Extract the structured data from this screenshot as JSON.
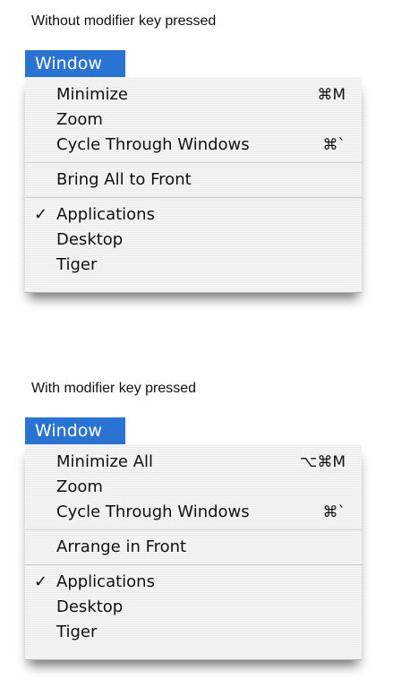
{
  "sections": [
    {
      "caption": "Without modifier key pressed",
      "menu_title": "Window",
      "group1": [
        {
          "label": "Minimize",
          "shortcut": "⌘M"
        },
        {
          "label": "Zoom",
          "shortcut": ""
        },
        {
          "label": "Cycle Through Windows",
          "shortcut": "⌘`"
        }
      ],
      "group2": [
        {
          "label": "Bring All to Front",
          "shortcut": ""
        }
      ],
      "group3": [
        {
          "label": "Applications",
          "checked": true,
          "check_glyph": "✓"
        },
        {
          "label": "Desktop",
          "checked": false
        },
        {
          "label": "Tiger",
          "checked": false
        }
      ]
    },
    {
      "caption": "With modifier key pressed",
      "menu_title": "Window",
      "group1": [
        {
          "label": "Minimize All",
          "shortcut": "⌥⌘M"
        },
        {
          "label": "Zoom",
          "shortcut": ""
        },
        {
          "label": "Cycle Through Windows",
          "shortcut": "⌘`"
        }
      ],
      "group2": [
        {
          "label": "Arrange in Front",
          "shortcut": ""
        }
      ],
      "group3": [
        {
          "label": "Applications",
          "checked": true,
          "check_glyph": "✓"
        },
        {
          "label": "Desktop",
          "checked": false
        },
        {
          "label": "Tiger",
          "checked": false
        }
      ]
    }
  ],
  "colors": {
    "menu_title_bg": "#2a73d2",
    "menu_title_text": "#ffffff",
    "menu_bg": "#efefef",
    "separator": "#cfcfcf"
  }
}
